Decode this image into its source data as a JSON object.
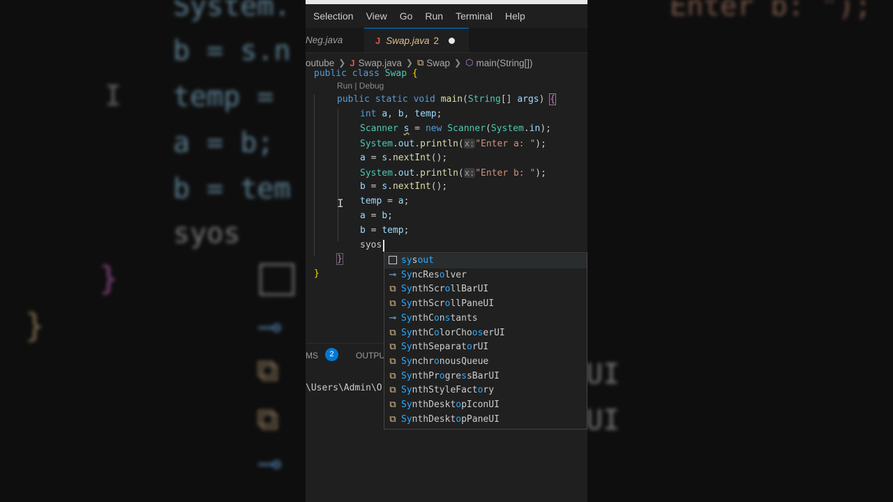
{
  "background": {
    "code_lines": [
      "System.",
      "b = s.n",
      "temp =",
      "a = b;",
      "b = tem",
      "syos"
    ],
    "right_lines": [
      "Enter b: \");",
      "UI",
      "UI",
      "UI"
    ]
  },
  "menubar": {
    "items": [
      "Selection",
      "View",
      "Go",
      "Run",
      "Terminal",
      "Help"
    ]
  },
  "tabs": [
    {
      "label": "Neg.java"
    },
    {
      "label": "Swap.java",
      "problems": "2",
      "modified": true
    }
  ],
  "breadcrumb": {
    "folder": "outube",
    "file": "Swap.java",
    "class": "Swap",
    "method": "main(String[])"
  },
  "editor": {
    "codelens": "Run | Debug",
    "lines": {
      "l0a": "public class ",
      "l0b": "Swap",
      "l0c": " {",
      "l1a": "public static void ",
      "l1b": "main",
      "l1c": "(",
      "l1d": "String",
      "l1e": "[] ",
      "l1f": "args",
      "l1g": ") ",
      "l1h": "{",
      "l2a": "int ",
      "l2b": "a",
      "l2c": ", ",
      "l2d": "b",
      "l2e": ", ",
      "l2f": "temp",
      "l2g": ";",
      "l3a": "Scanner ",
      "l3b": "s",
      "l3c": " = ",
      "l3d": "new ",
      "l3e": "Scanner",
      "l3f": "(",
      "l3g": "System",
      "l3h": ".",
      "l3i": "in",
      "l3j": ");",
      "l4a": "System",
      "l4b": ".",
      "l4c": "out",
      "l4d": ".",
      "l4e": "println",
      "l4f": "(",
      "l4g": "x:",
      "l4h": "\"Enter a: \"",
      "l4i": ");",
      "l5a": "a",
      "l5b": " = ",
      "l5c": "s",
      "l5d": ".",
      "l5e": "nextInt",
      "l5f": "();",
      "l6a": "System",
      "l6b": ".",
      "l6c": "out",
      "l6d": ".",
      "l6e": "println",
      "l6f": "(",
      "l6g": "x:",
      "l6h": "\"Enter b: \"",
      "l6i": ");",
      "l7a": "b",
      "l7b": " = ",
      "l7c": "s",
      "l7d": ".",
      "l7e": "nextInt",
      "l7f": "();",
      "l8a": "temp",
      "l8b": " = ",
      "l8c": "a",
      "l8d": ";",
      "l9a": "a",
      "l9b": " = ",
      "l9c": "b",
      "l9d": ";",
      "l10a": "b",
      "l10b": " = ",
      "l10c": "temp",
      "l10d": ";",
      "l11a": "syos",
      "l12a": "}",
      "l13a": "}"
    }
  },
  "bottom_panel": {
    "problems_label": "MS",
    "problems_count": "2",
    "output_label": "OUTPU",
    "terminal_text": "\\Users\\Admin\\O"
  },
  "suggestions": [
    {
      "kind": "snippet",
      "icon": "snippet-icon",
      "parts": [
        "sy",
        "s",
        "out"
      ],
      "match": [
        true,
        false,
        true
      ]
    },
    {
      "kind": "interface",
      "icon": "interface-icon",
      "parts": [
        "Sy",
        "ncRes",
        "o",
        "lver"
      ],
      "match": [
        true,
        false,
        true,
        false
      ]
    },
    {
      "kind": "class",
      "icon": "class-icon",
      "parts": [
        "Sy",
        "nthScr",
        "o",
        "llBarUI"
      ],
      "match": [
        true,
        false,
        true,
        false
      ]
    },
    {
      "kind": "class",
      "icon": "class-icon",
      "parts": [
        "Sy",
        "nthScr",
        "o",
        "llPaneUI"
      ],
      "match": [
        true,
        false,
        true,
        false
      ]
    },
    {
      "kind": "interface",
      "icon": "interface-icon",
      "parts": [
        "Sy",
        "nthC",
        "o",
        "n",
        "s",
        "tants"
      ],
      "match": [
        true,
        false,
        true,
        false,
        true,
        false
      ]
    },
    {
      "kind": "class",
      "icon": "class-icon",
      "parts": [
        "Sy",
        "nthC",
        "o",
        "lorCho",
        "os",
        "erUI"
      ],
      "match": [
        true,
        false,
        true,
        false,
        true,
        false
      ]
    },
    {
      "kind": "class",
      "icon": "class-icon",
      "parts": [
        "Sy",
        "nthSeparat",
        "o",
        "rUI"
      ],
      "match": [
        true,
        false,
        true,
        false
      ]
    },
    {
      "kind": "class",
      "icon": "class-icon",
      "parts": [
        "Sy",
        "nchr",
        "o",
        "nousQueue"
      ],
      "match": [
        true,
        false,
        true,
        false
      ]
    },
    {
      "kind": "class",
      "icon": "class-icon",
      "parts": [
        "Sy",
        "nthPr",
        "o",
        "gre",
        "s",
        "sBarUI"
      ],
      "match": [
        true,
        false,
        true,
        false,
        true,
        false
      ]
    },
    {
      "kind": "class",
      "icon": "class-icon",
      "parts": [
        "Sy",
        "nthStyleFact",
        "o",
        "ry"
      ],
      "match": [
        true,
        false,
        true,
        false
      ]
    },
    {
      "kind": "class",
      "icon": "class-icon",
      "parts": [
        "Sy",
        "nthDeskt",
        "o",
        "pIconUI"
      ],
      "match": [
        true,
        false,
        true,
        false
      ]
    },
    {
      "kind": "class",
      "icon": "class-icon",
      "parts": [
        "Sy",
        "nthDeskt",
        "o",
        "pPaneUI"
      ],
      "match": [
        true,
        false,
        true,
        false
      ]
    }
  ],
  "colors": {
    "editor_bg": "#1f1f1f",
    "accent": "#0078d4",
    "match_highlight": "#2aaaff",
    "class_icon": "#e2c08d",
    "interface_icon": "#75beff"
  }
}
